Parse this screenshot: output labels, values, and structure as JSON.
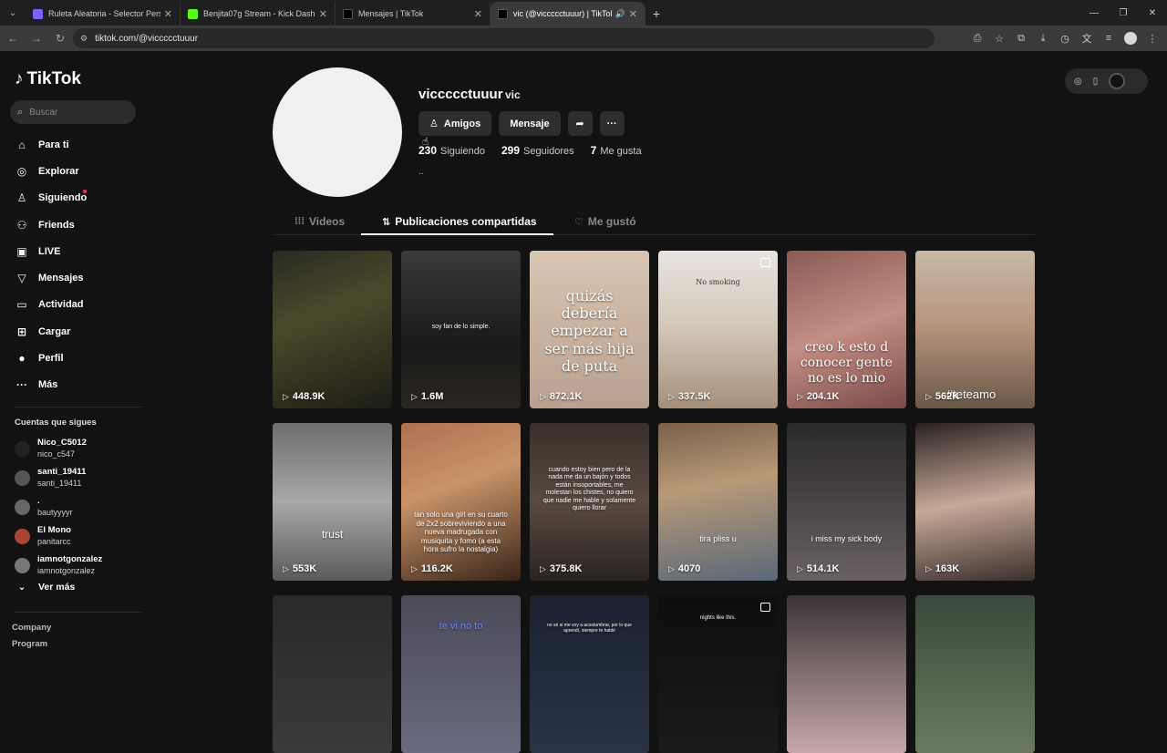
{
  "browser": {
    "tabs": [
      {
        "title": "Ruleta Aleatoria - Selector Perso",
        "color": "#7b61ff"
      },
      {
        "title": "Benjita07g Stream - Kick Dashbo",
        "color": "#53fc18"
      },
      {
        "title": "Mensajes | TikTok",
        "color": "#111111"
      },
      {
        "title": "vic (@viccccctuuur) | TikTok",
        "color": "#111111"
      }
    ],
    "url": "tiktok.com/@viccccctuuur"
  },
  "sidebar": {
    "logo": "TikTok",
    "search_placeholder": "Buscar",
    "menu": [
      {
        "label": "Para ti",
        "icon": "home-icon",
        "glyph": "⌂"
      },
      {
        "label": "Explorar",
        "icon": "compass-icon",
        "glyph": "◎"
      },
      {
        "label": "Siguiendo",
        "icon": "following-icon",
        "glyph": "♙"
      },
      {
        "label": "Friends",
        "icon": "friends-icon",
        "glyph": "⚇"
      },
      {
        "label": "LIVE",
        "icon": "live-icon",
        "glyph": "▣"
      },
      {
        "label": "Mensajes",
        "icon": "inbox-icon",
        "glyph": "▽"
      },
      {
        "label": "Actividad",
        "icon": "activity-icon",
        "glyph": "▭"
      },
      {
        "label": "Cargar",
        "icon": "upload-icon",
        "glyph": "⊞"
      },
      {
        "label": "Perfil",
        "icon": "profile-icon",
        "glyph": "●"
      },
      {
        "label": "Más",
        "icon": "more-icon",
        "glyph": "···"
      }
    ],
    "following_title": "Cuentas que sigues",
    "following": [
      {
        "name": "Nico_C5012",
        "handle": "nico_c547"
      },
      {
        "name": "santi_19411",
        "handle": "santi_19411"
      },
      {
        "name": ".",
        "handle": "bautyyyyr"
      },
      {
        "name": "El Mono",
        "handle": "panitarcc"
      },
      {
        "name": "iamnotgonzalez",
        "handle": "iamnotgonzalez"
      }
    ],
    "see_more": "Ver más",
    "footer": [
      "Company",
      "Program"
    ]
  },
  "profile": {
    "username": "viccccctuuur",
    "display_name": "vic",
    "btn_friends": "Amigos",
    "btn_message": "Mensaje",
    "following_count": "230",
    "following_label": "Siguiendo",
    "followers_count": "299",
    "followers_label": "Seguidores",
    "likes_count": "7",
    "likes_label": "Me gusta",
    "bio": ".."
  },
  "tabs": {
    "videos": "Videos",
    "reposts": "Publicaciones compartidas",
    "liked": "Me gustó"
  },
  "videos": [
    {
      "views": "448.9K",
      "caption": "",
      "bg": "linear-gradient(160deg,#2a2a22,#4a4a2a 40%,#1d1c15)"
    },
    {
      "views": "1.6M",
      "caption": "soy fan de lo simple.",
      "bg": "linear-gradient(180deg,#3a3a3a,#1a1a1a 60%,#2a2620)"
    },
    {
      "views": "872.1K",
      "caption": "quizás debería empezar a ser más hija de puta",
      "bg": "linear-gradient(180deg,#d9c6b4,#c9b2a0 50%,#b8a190)"
    },
    {
      "views": "337.5K",
      "caption": "No smoking",
      "bg": "linear-gradient(180deg,#e8e4de,#d2c6b8 50%,#a5907a)"
    },
    {
      "views": "204.1K",
      "caption": "creo k esto d conocer gente no es lo mio",
      "bg": "linear-gradient(160deg,#8a5a55,#c58e84 50%,#7a4a48)"
    },
    {
      "views": "562K",
      "caption": "#teteamo",
      "bg": "linear-gradient(180deg,#c9b9a8,#b5927a 50%,#6a5848)"
    },
    {
      "views": "553K",
      "caption": "trust",
      "bg": "linear-gradient(180deg,#6e6e6e,#a8a8a8 50%,#5a5a5a)"
    },
    {
      "views": "116.2K",
      "caption": "tan solo una girl en su cuarto de 2x2 sobreviviendo a una nueva madrugada con musiquita y fomo (a esta hora sufro la nostalgia)",
      "bg": "linear-gradient(160deg,#b07050,#c9946a 40%,#3a2418)"
    },
    {
      "views": "375.8K",
      "caption": "cuando estoy bien pero de la nada me da un bajón y todos están insoportables, me molestan los chistes, no quiero que nadie me hable y solamente quiero llorar",
      "bg": "linear-gradient(180deg,#3a302a,#5a4a40 50%,#2a2420)"
    },
    {
      "views": "4070",
      "caption": "tira pliss u",
      "bg": "linear-gradient(170deg,#7a6048,#b89a78 40%,#5a6878)"
    },
    {
      "views": "514.1K",
      "caption": "i miss my sick body",
      "bg": "linear-gradient(180deg,#2a2a2a,#4a4444 50%,#6a6262)"
    },
    {
      "views": "163K",
      "caption": "",
      "bg": "linear-gradient(170deg,#2a2220,#c8a898 50%,#3a302c)"
    },
    {
      "views": "",
      "caption": "",
      "bg": "linear-gradient(180deg,#2a2a2a,#3a3a3a)"
    },
    {
      "views": "",
      "caption": "te vi no to",
      "bg": "linear-gradient(180deg,#4a4a58,#6a6a80)"
    },
    {
      "views": "",
      "caption": "no sé si me voy a acostumbrar, por lo que aprendí, siempre te hablé",
      "bg": "linear-gradient(180deg,#1a2230,#2a3448)"
    },
    {
      "views": "",
      "caption": "nights like this.",
      "bg": "linear-gradient(180deg,#0e0e0e,#1a1a1a)"
    },
    {
      "views": "",
      "caption": "",
      "bg": "linear-gradient(180deg,#3a3438,#c8a8a8)"
    },
    {
      "views": "",
      "caption": "",
      "bg": "linear-gradient(180deg,#3a4a3a,#6a7a60)"
    }
  ]
}
